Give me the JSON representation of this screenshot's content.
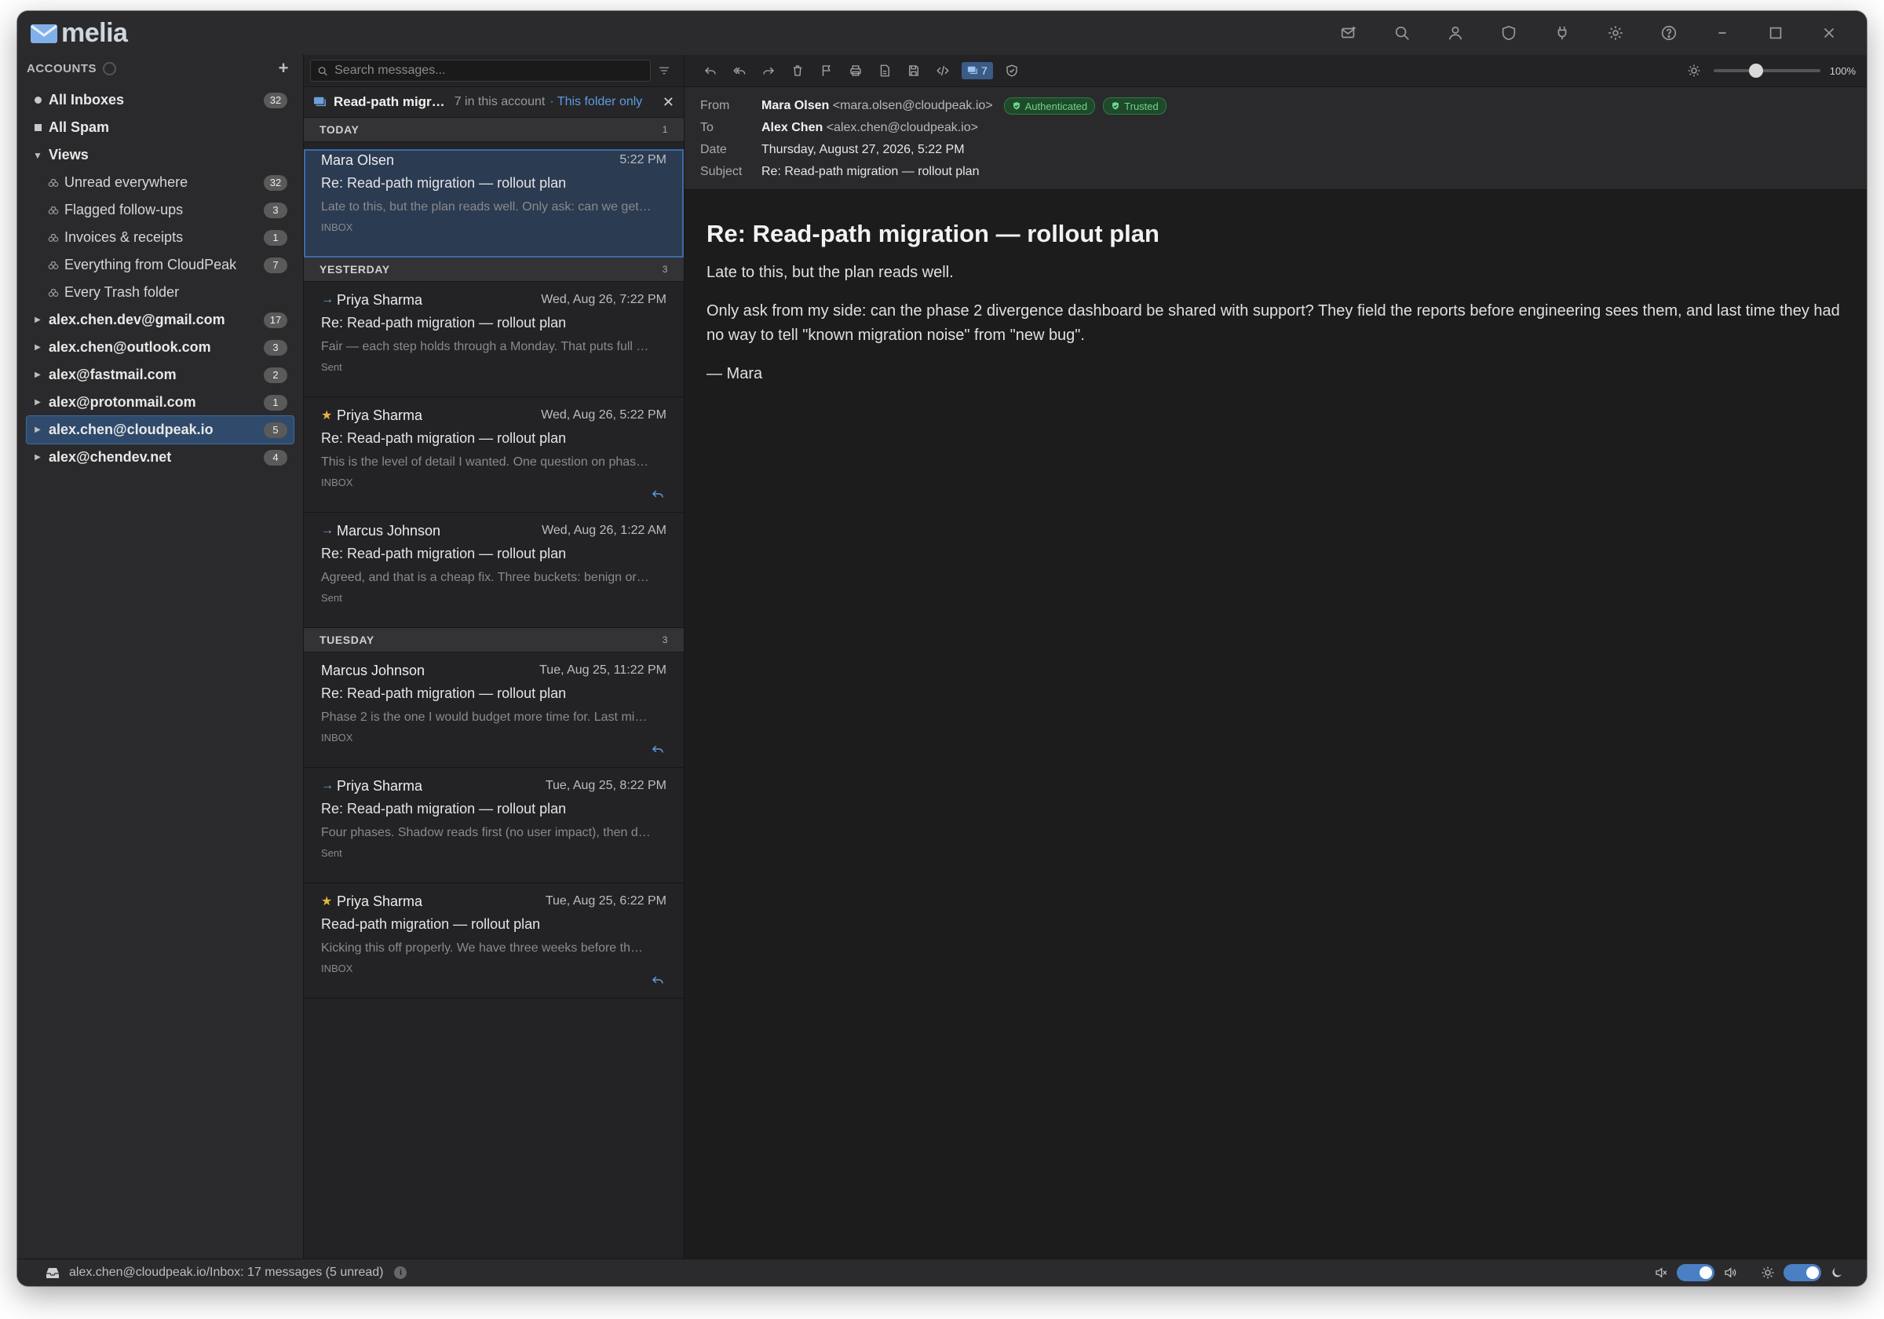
{
  "app": {
    "name": "melia"
  },
  "sidebar": {
    "header": "ACCOUNTS",
    "items": [
      {
        "label": "All Inboxes",
        "count": "32",
        "kind": "dot"
      },
      {
        "label": "All Spam",
        "count": "",
        "kind": "square"
      },
      {
        "label": "Views",
        "count": "",
        "kind": "caret-down"
      },
      {
        "label": "Unread everywhere",
        "count": "32",
        "kind": "view"
      },
      {
        "label": "Flagged follow-ups",
        "count": "3",
        "kind": "view"
      },
      {
        "label": "Invoices & receipts",
        "count": "1",
        "kind": "view"
      },
      {
        "label": "Everything from CloudPeak",
        "count": "7",
        "kind": "view"
      },
      {
        "label": "Every Trash folder",
        "count": "",
        "kind": "view"
      },
      {
        "label": "alex.chen.dev@gmail.com",
        "count": "17",
        "kind": "caret-right"
      },
      {
        "label": "alex.chen@outlook.com",
        "count": "3",
        "kind": "caret-right"
      },
      {
        "label": "alex@fastmail.com",
        "count": "2",
        "kind": "caret-right"
      },
      {
        "label": "alex@protonmail.com",
        "count": "1",
        "kind": "caret-right"
      },
      {
        "label": "alex.chen@cloudpeak.io",
        "count": "5",
        "kind": "caret-right",
        "selected": true
      },
      {
        "label": "alex@chendev.net",
        "count": "4",
        "kind": "caret-right"
      }
    ]
  },
  "search": {
    "placeholder": "Search messages..."
  },
  "thread": {
    "title": "Read-path migr…",
    "count": "7 in this account",
    "folder_link": "· This folder only"
  },
  "groups": [
    {
      "label": "TODAY",
      "count": "1",
      "messages": [
        {
          "from": "Mara Olsen",
          "date": "5:22 PM",
          "subject": "Re: Read-path migration — rollout plan",
          "preview": "Late to this, but the plan reads well. Only ask: can we get…",
          "folder": "INBOX",
          "marker": "",
          "replied": false,
          "selected": true
        }
      ]
    },
    {
      "label": "YESTERDAY",
      "count": "3",
      "messages": [
        {
          "from": "Priya Sharma",
          "date": "Wed, Aug 26, 7:22 PM",
          "subject": "Re: Read-path migration — rollout plan",
          "preview": "Fair — each step holds through a Monday. That puts full …",
          "folder": "Sent",
          "marker": "→",
          "replied": false
        },
        {
          "from": "Priya Sharma",
          "date": "Wed, Aug 26, 5:22 PM",
          "subject": "Re: Read-path migration — rollout plan",
          "preview": "This is the level of detail I wanted. One question on phas…",
          "folder": "INBOX",
          "marker": "★",
          "replied": true
        },
        {
          "from": "Marcus Johnson",
          "date": "Wed, Aug 26, 1:22 AM",
          "subject": "Re: Read-path migration — rollout plan",
          "preview": "Agreed, and that is a cheap fix. Three buckets: benign or…",
          "folder": "Sent",
          "marker": "→",
          "replied": false
        }
      ]
    },
    {
      "label": "TUESDAY",
      "count": "3",
      "messages": [
        {
          "from": "Marcus Johnson",
          "date": "Tue, Aug 25, 11:22 PM",
          "subject": "Re: Read-path migration — rollout plan",
          "preview": "Phase 2 is the one I would budget more time for. Last mi…",
          "folder": "INBOX",
          "marker": "",
          "replied": true
        },
        {
          "from": "Priya Sharma",
          "date": "Tue, Aug 25, 8:22 PM",
          "subject": "Re: Read-path migration — rollout plan",
          "preview": "Four phases. Shadow reads first (no user impact), then d…",
          "folder": "Sent",
          "marker": "→",
          "replied": false
        },
        {
          "from": "Priya Sharma",
          "date": "Tue, Aug 25, 6:22 PM",
          "subject": "Read-path migration — rollout plan",
          "preview": "Kicking this off properly. We have three weeks before th…",
          "folder": "INBOX",
          "marker": "★",
          "replied": true
        }
      ]
    }
  ],
  "reader": {
    "thread_count": "7",
    "zoom": "100%",
    "zoom_level": 0.4,
    "headers": {
      "from_key": "From",
      "from_name": "Mara Olsen",
      "from_addr": "<mara.olsen@cloudpeak.io>",
      "auth_badge": "Authenticated",
      "trust_badge": "Trusted",
      "to_key": "To",
      "to_name": "Alex Chen",
      "to_addr": "<alex.chen@cloudpeak.io>",
      "date_key": "Date",
      "date_val": "Thursday, August 27, 2026, 5:22 PM",
      "subject_key": "Subject",
      "subject_val": "Re: Read-path migration — rollout plan"
    },
    "body": {
      "title": "Re: Read-path migration — rollout plan",
      "paragraphs": [
        "Late to this, but the plan reads well.",
        "Only ask from my side: can the phase 2 divergence dashboard be shared with support? They field the reports before engineering sees them, and last time they had no way to tell \"known migration noise\" from \"new bug\".",
        "— Mara"
      ]
    }
  },
  "status": {
    "text": "alex.chen@cloudpeak.io/Inbox: 17 messages (5 unread)",
    "info": "i"
  },
  "colors": {
    "accent": "#3d6aa8",
    "star": "#e7b43a",
    "auth_green": "#6fd48a"
  }
}
